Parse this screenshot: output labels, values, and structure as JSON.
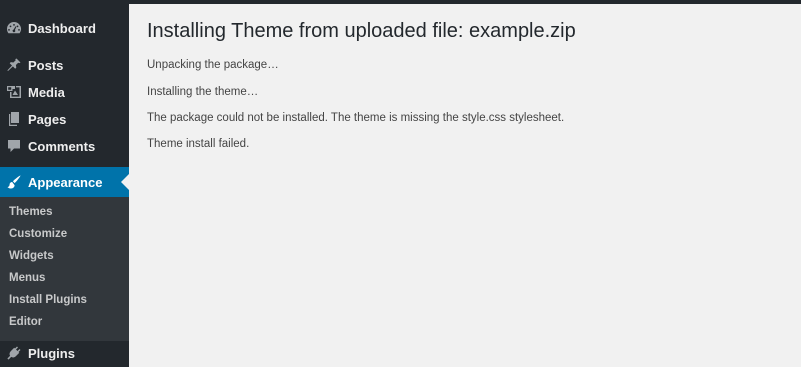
{
  "sidebar": {
    "items": [
      {
        "label": "Dashboard",
        "icon": "dashboard-icon"
      },
      {
        "label": "Posts",
        "icon": "pin-icon"
      },
      {
        "label": "Media",
        "icon": "media-icon"
      },
      {
        "label": "Pages",
        "icon": "pages-icon"
      },
      {
        "label": "Comments",
        "icon": "comment-icon"
      },
      {
        "label": "Appearance",
        "icon": "brush-icon",
        "current": true
      },
      {
        "label": "Plugins",
        "icon": "plug-icon"
      }
    ],
    "submenu": [
      {
        "label": "Themes"
      },
      {
        "label": "Customize"
      },
      {
        "label": "Widgets"
      },
      {
        "label": "Menus"
      },
      {
        "label": "Install Plugins"
      },
      {
        "label": "Editor"
      }
    ]
  },
  "main": {
    "title": "Installing Theme from uploaded file: example.zip",
    "log": [
      "Unpacking the package…",
      "Installing the theme…",
      "The package could not be installed. The theme is missing the style.css stylesheet.",
      "Theme install failed."
    ]
  },
  "colors": {
    "sidebar_bg": "#23282d",
    "submenu_bg": "#32373c",
    "current_bg": "#0073aa",
    "content_bg": "#f1f1f1"
  }
}
